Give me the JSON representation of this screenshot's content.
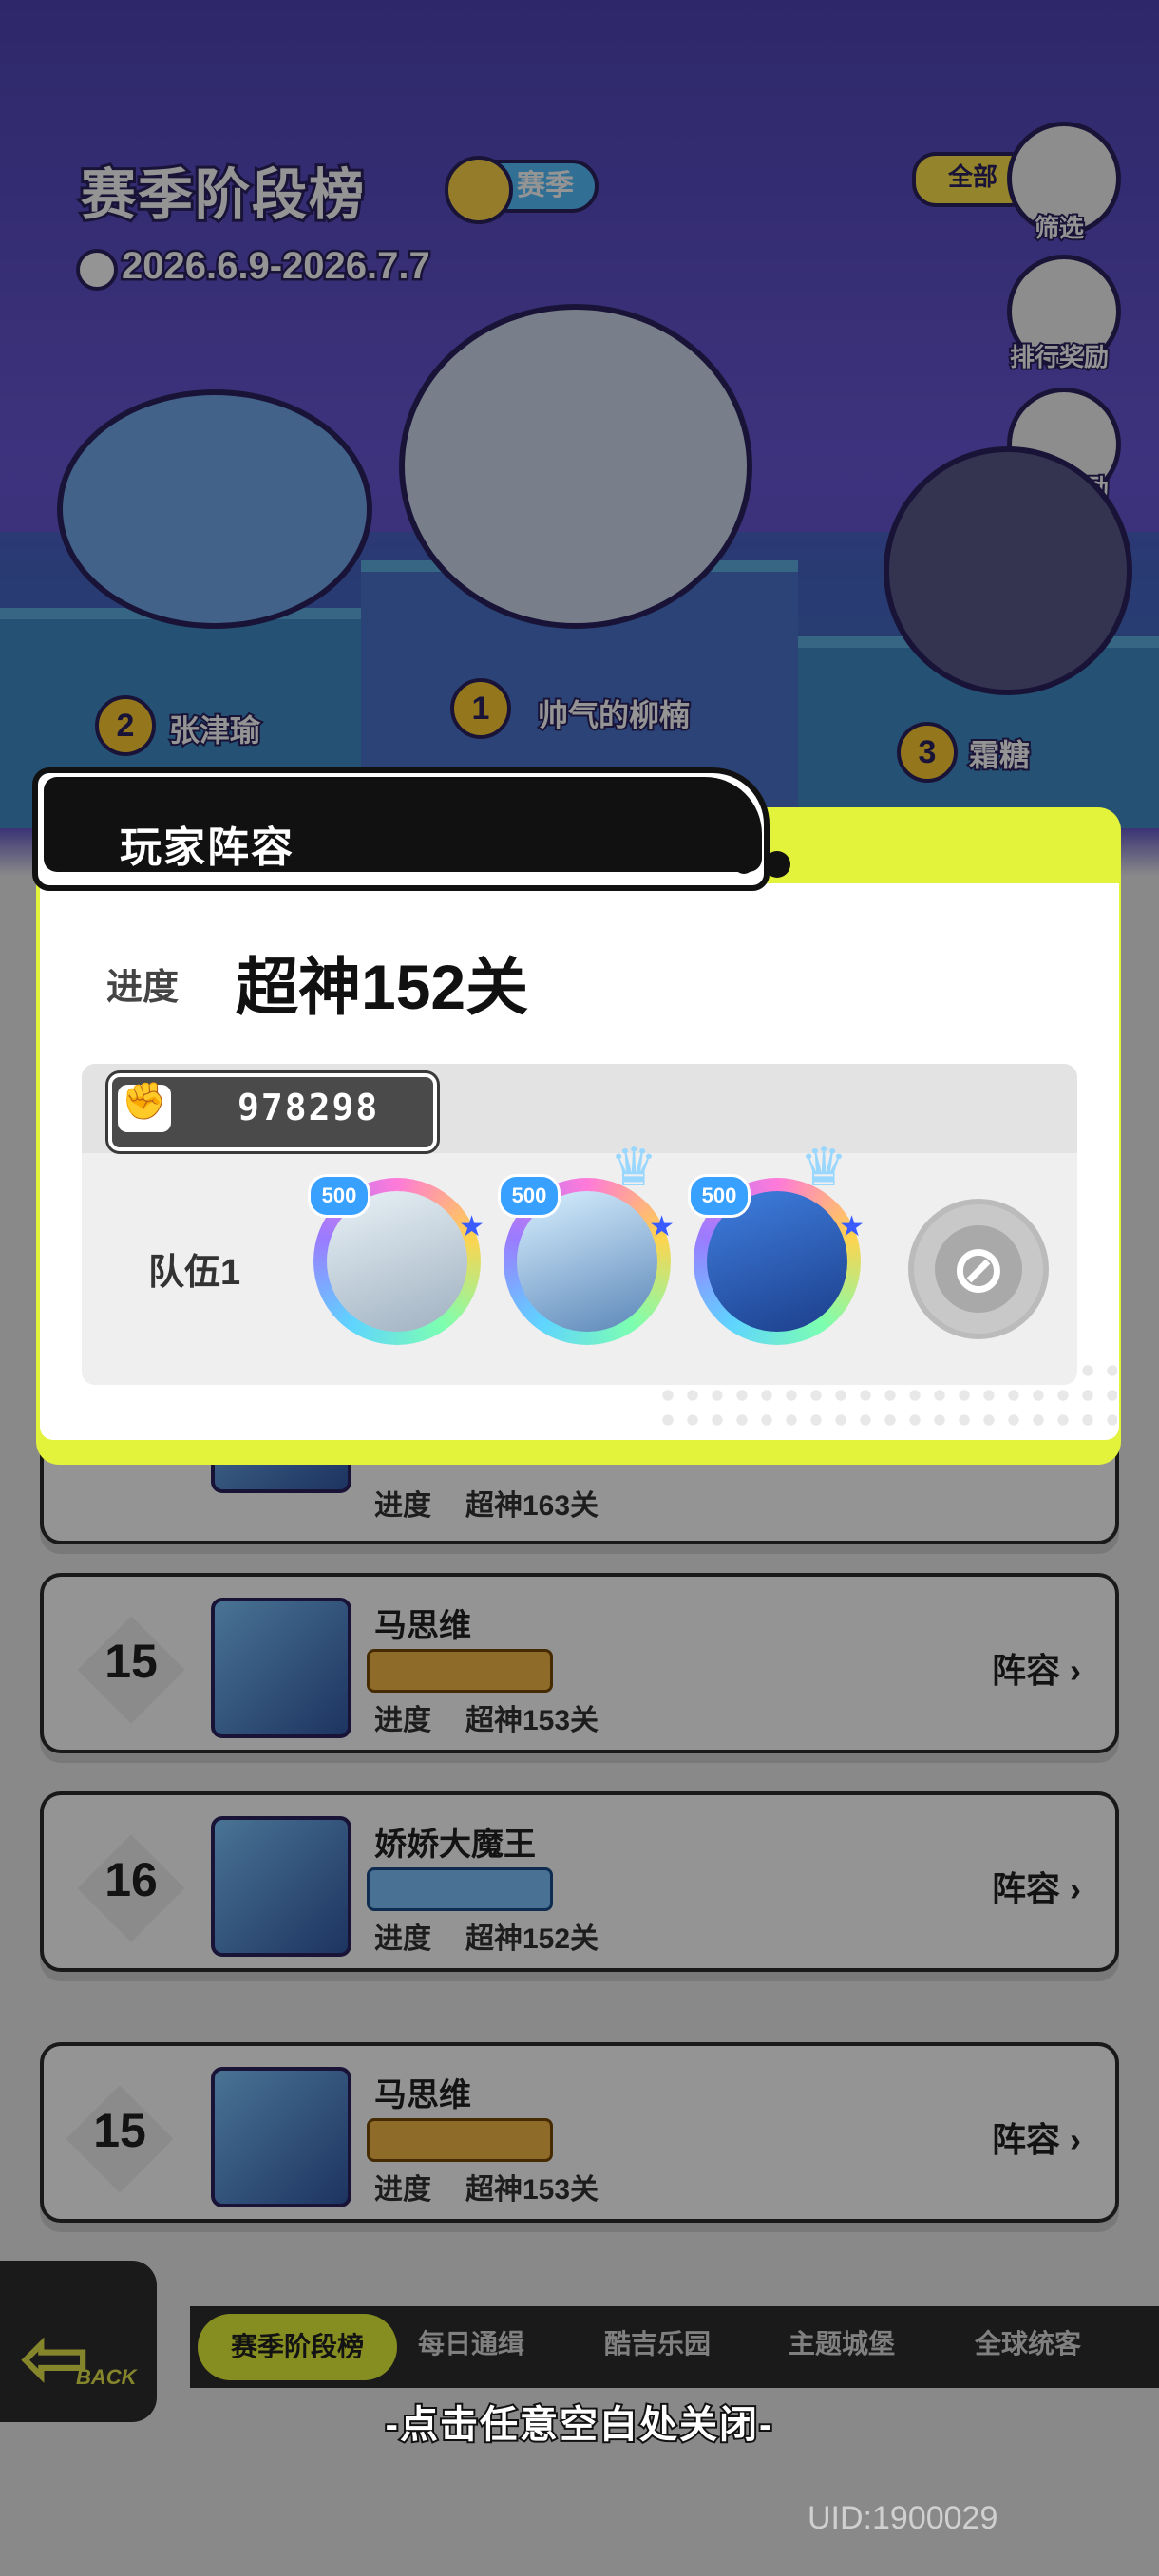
{
  "header": {
    "title": "赛季阶段榜",
    "season_badge": "赛季",
    "date_range": "2026.6.9-2026.7.7",
    "filter_chip": "全部"
  },
  "side_buttons": [
    {
      "label": "筛选",
      "icon": "filter-icon"
    },
    {
      "label": "排行奖励",
      "icon": "reward-icon"
    },
    {
      "label": "首通奖励",
      "icon": "first-clear-icon"
    }
  ],
  "podium": [
    {
      "rank": "2",
      "name": "张津瑜"
    },
    {
      "rank": "1",
      "name": "帅气的柳楠"
    },
    {
      "rank": "3",
      "name": "霜糖"
    }
  ],
  "ranking_rows": [
    {
      "rank": "",
      "name": "",
      "progress_label": "进度",
      "progress": "超神163关",
      "lineup": ""
    },
    {
      "rank": "15",
      "name": "马思维",
      "progress_label": "进度",
      "progress": "超神153关",
      "lineup": "阵容"
    },
    {
      "rank": "16",
      "name": "娇娇大魔王",
      "progress_label": "进度",
      "progress": "超神152关",
      "lineup": "阵容"
    },
    {
      "rank": "15",
      "name": "马思维",
      "progress_label": "进度",
      "progress": "超神153关",
      "lineup": "阵容"
    }
  ],
  "bottom_nav": {
    "back_label": "BACK",
    "tabs": [
      "赛季阶段榜",
      "每日通缉",
      "酷吉乐园",
      "主题城堡",
      "全球统客"
    ]
  },
  "popup": {
    "title": "玩家阵容",
    "progress_label": "进度",
    "progress_value": "超神152关",
    "power_value": "978298",
    "team_label": "队伍1",
    "heroes": [
      {
        "level": "500",
        "icon": "hero-silver-hair-icon"
      },
      {
        "level": "500",
        "icon": "hero-pirate-captain-icon"
      },
      {
        "level": "500",
        "icon": "hero-blue-hair-icon"
      }
    ],
    "empty_slot_icon": "ban-icon"
  },
  "close_hint": "-点击任意空白处关闭-",
  "uid": "UID:1900029",
  "colors": {
    "accent_lime": "#e3f23a",
    "popup_header": "#111111",
    "season_blue": "#56c0ff"
  }
}
